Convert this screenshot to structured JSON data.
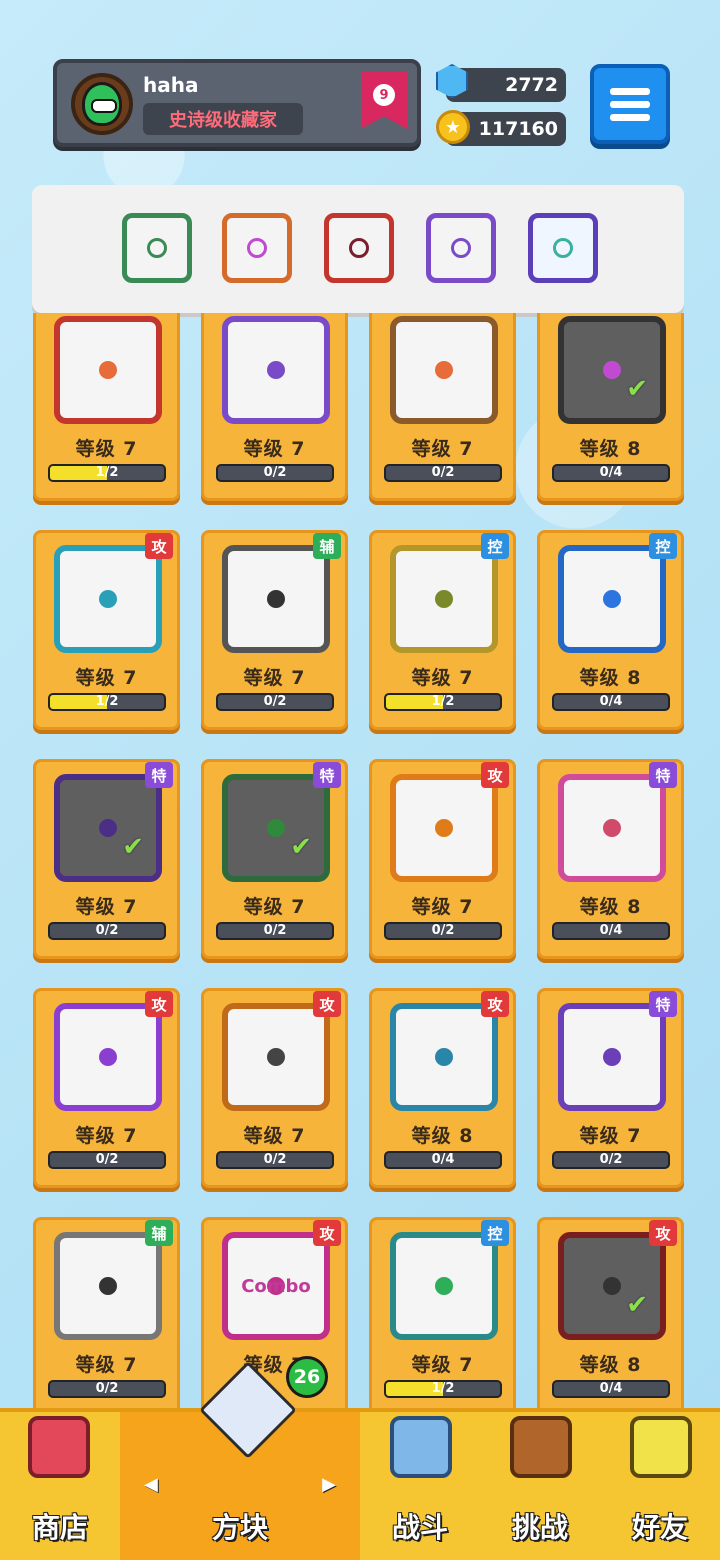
{
  "header": {
    "username": "haha",
    "title": "史诗级收藏家",
    "rank": "9",
    "gems": "2772",
    "coins": "117160"
  },
  "equipped": [
    {
      "icon": "pentagram-icon",
      "color": "#3a8a56"
    },
    {
      "icon": "infinity-icon",
      "color": "#d46b2b"
    },
    {
      "icon": "saw-blade-icon",
      "color": "#c2362e"
    },
    {
      "icon": "eye-icon",
      "color": "#7a4bc8"
    },
    {
      "icon": "hands-icon",
      "color": "#5a3fb8"
    }
  ],
  "cards": [
    {
      "level": "等级 7",
      "progress": "1/2",
      "fill": 0.5,
      "tag": "",
      "frame": "#c2362e",
      "dot": "#e86b3a",
      "dim": false,
      "check": false
    },
    {
      "level": "等级 7",
      "progress": "0/2",
      "fill": 0,
      "tag": "",
      "frame": "#7a4bc8",
      "dot": "#7a4bc8",
      "dim": false,
      "check": false
    },
    {
      "level": "等级 7",
      "progress": "0/2",
      "fill": 0,
      "tag": "",
      "frame": "#8b5a2b",
      "dot": "#e86b3a",
      "dim": false,
      "check": false
    },
    {
      "level": "等级 8",
      "progress": "0/4",
      "fill": 0,
      "tag": "",
      "frame": "#333333",
      "dot": "#c04bd0",
      "dim": true,
      "check": true
    },
    {
      "level": "等级 7",
      "progress": "1/2",
      "fill": 0.5,
      "tag": "攻",
      "tagColor": "#e23a3a",
      "frame": "#2aa0b8",
      "dot": "#2aa0b8",
      "dim": false,
      "check": false
    },
    {
      "level": "等级 7",
      "progress": "0/2",
      "fill": 0,
      "tag": "辅",
      "tagColor": "#2fae5a",
      "frame": "#555555",
      "dot": "#333333",
      "dim": false,
      "check": false
    },
    {
      "level": "等级 7",
      "progress": "1/2",
      "fill": 0.5,
      "tag": "控",
      "tagColor": "#2c8fe0",
      "frame": "#b5962a",
      "dot": "#7a8a2b",
      "dim": false,
      "check": false
    },
    {
      "level": "等级 8",
      "progress": "0/4",
      "fill": 0,
      "tag": "控",
      "tagColor": "#2c8fe0",
      "frame": "#2567c4",
      "dot": "#2c74e0",
      "dim": false,
      "check": false
    },
    {
      "level": "等级 7",
      "progress": "0/2",
      "fill": 0,
      "tag": "特",
      "tagColor": "#8a4bd8",
      "frame": "#4b2f86",
      "dot": "#4b2f86",
      "dim": true,
      "check": true
    },
    {
      "level": "等级 7",
      "progress": "0/2",
      "fill": 0,
      "tag": "特",
      "tagColor": "#8a4bd8",
      "frame": "#2f6a3c",
      "dot": "#2f8a3c",
      "dim": true,
      "check": true
    },
    {
      "level": "等级 7",
      "progress": "0/2",
      "fill": 0,
      "tag": "攻",
      "tagColor": "#e23a3a",
      "frame": "#e07b1a",
      "dot": "#e07b1a",
      "dim": false,
      "check": false
    },
    {
      "level": "等级 8",
      "progress": "0/4",
      "fill": 0,
      "tag": "特",
      "tagColor": "#8a4bd8",
      "frame": "#d04b9a",
      "dot": "#d04b6a",
      "dim": false,
      "check": false
    },
    {
      "level": "等级 7",
      "progress": "0/2",
      "fill": 0,
      "tag": "攻",
      "tagColor": "#e23a3a",
      "frame": "#8a3fd0",
      "dot": "#8a3fd0",
      "dim": false,
      "check": false
    },
    {
      "level": "等级 7",
      "progress": "0/2",
      "fill": 0,
      "tag": "攻",
      "tagColor": "#e23a3a",
      "frame": "#c06a1a",
      "dot": "#444444",
      "dim": false,
      "check": false
    },
    {
      "level": "等级 8",
      "progress": "0/4",
      "fill": 0,
      "tag": "攻",
      "tagColor": "#e23a3a",
      "frame": "#2a86a8",
      "dot": "#2a86a8",
      "dim": false,
      "check": false
    },
    {
      "level": "等级 7",
      "progress": "0/2",
      "fill": 0,
      "tag": "特",
      "tagColor": "#8a4bd8",
      "frame": "#6a3fb8",
      "dot": "#6a3fb8",
      "dim": false,
      "check": false
    },
    {
      "level": "等级 7",
      "progress": "0/2",
      "fill": 0,
      "tag": "辅",
      "tagColor": "#2fae5a",
      "frame": "#777777",
      "dot": "#333333",
      "dim": false,
      "check": false
    },
    {
      "level": "等级 7",
      "progress": "",
      "fill": 0,
      "tag": "攻",
      "tagColor": "#e23a3a",
      "frame": "#c02f8a",
      "dot": "#c02f8a",
      "dim": false,
      "check": false,
      "text": "Combo"
    },
    {
      "level": "等级 7",
      "progress": "1/2",
      "fill": 0.5,
      "tag": "控",
      "tagColor": "#2c8fe0",
      "frame": "#2a8a8a",
      "dot": "#2fae5a",
      "dim": false,
      "check": false
    },
    {
      "level": "等级 8",
      "progress": "0/4",
      "fill": 0,
      "tag": "攻",
      "tagColor": "#e23a3a",
      "frame": "#7a1f1f",
      "dot": "#333333",
      "dim": true,
      "check": true
    }
  ],
  "nav": {
    "shop": "商店",
    "blocks": "方块",
    "battle": "战斗",
    "challenge": "挑战",
    "friends": "好友",
    "blocks_badge": "26",
    "left_arrow": "◀",
    "right_arrow": "▶"
  },
  "colors": {
    "accent": "#1f8ff0",
    "card": "#f7b43a",
    "nav": "#f5c632"
  }
}
